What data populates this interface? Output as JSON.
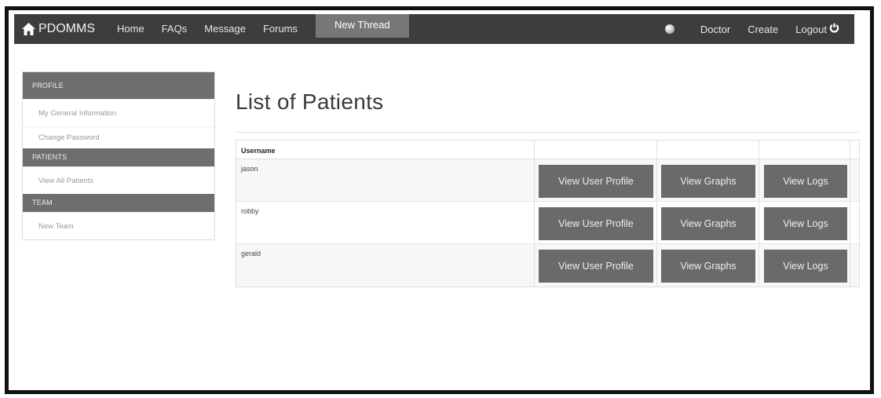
{
  "navbar": {
    "brand": "PDOMMS",
    "left_links": [
      {
        "label": "Home"
      },
      {
        "label": "FAQs"
      },
      {
        "label": "Message"
      },
      {
        "label": "Forums"
      },
      {
        "label": "New Thread",
        "active": true
      }
    ],
    "right_links": {
      "user": "Doctor",
      "create": "Create",
      "logout": "Logout"
    }
  },
  "sidebar": {
    "sections": [
      {
        "header": "PROFILE",
        "items": [
          "My General Information",
          "Change Password"
        ]
      },
      {
        "header": "PATIENTS",
        "items": [
          "View All Patients"
        ]
      },
      {
        "header": "TEAM",
        "items": [
          "New Team"
        ]
      }
    ]
  },
  "main": {
    "title": "List of Patients",
    "table": {
      "headers": [
        "Username",
        "",
        "",
        ""
      ],
      "rows": [
        {
          "username": "jason",
          "profile_btn": "View User Profile",
          "graphs_btn": "View Graphs",
          "logs_btn": "View Logs"
        },
        {
          "username": "robby",
          "profile_btn": "View User Profile",
          "graphs_btn": "View Graphs",
          "logs_btn": "View Logs"
        },
        {
          "username": "gerald",
          "profile_btn": "View User Profile",
          "graphs_btn": "View Graphs",
          "logs_btn": "View Logs"
        }
      ]
    }
  },
  "colors": {
    "navbar_bg": "#3d3d3d",
    "active_tab_bg": "#777777",
    "sidebar_header_bg": "#6e6e6e",
    "button_bg": "#6a6a6a"
  },
  "icons": {
    "brand": "home-icon",
    "user": "globe-icon",
    "logout": "power-icon"
  }
}
